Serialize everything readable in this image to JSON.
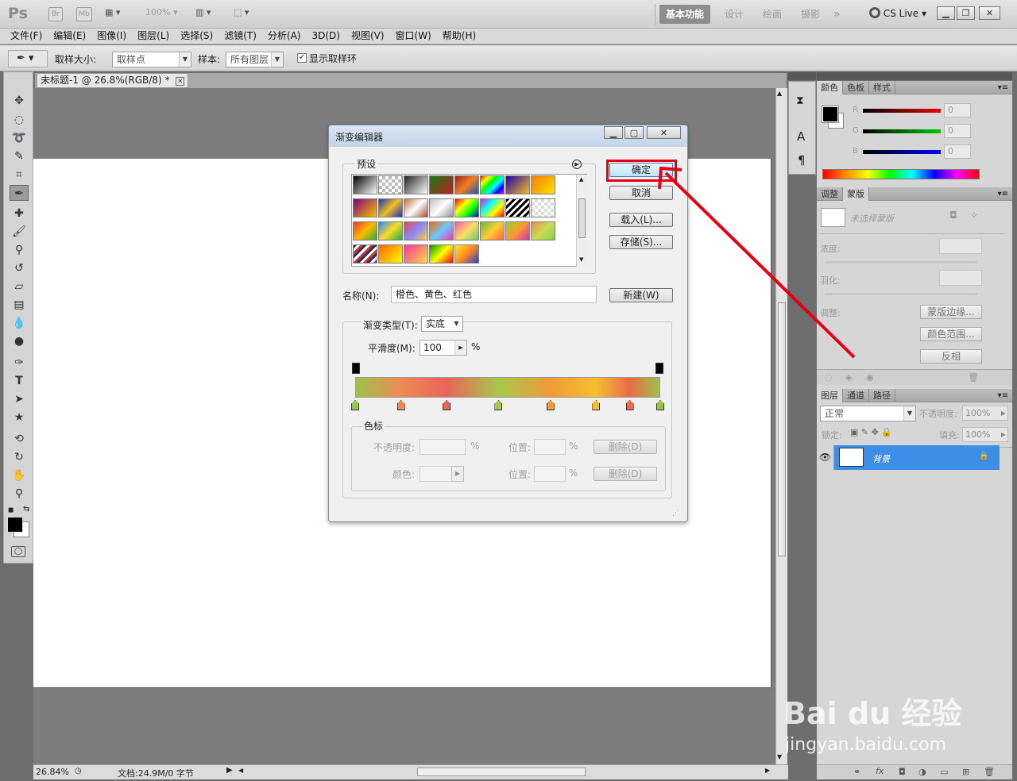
{
  "app": {
    "logo": "Ps",
    "bridge": "Br",
    "minibridge": "Mb",
    "zoom": "100%",
    "workspaces": [
      "基本功能",
      "设计",
      "绘画",
      "摄影"
    ],
    "more": "»",
    "cslive": "CS Live"
  },
  "menu": [
    "文件(F)",
    "编辑(E)",
    "图像(I)",
    "图层(L)",
    "选择(S)",
    "滤镜(T)",
    "分析(A)",
    "3D(D)",
    "视图(V)",
    "窗口(W)",
    "帮助(H)"
  ],
  "options": {
    "sample_size_label": "取样大小:",
    "sample_size_value": "取样点",
    "sample_label": "样本:",
    "sample_value": "所有图层",
    "show_ring_label": "显示取样环"
  },
  "document": {
    "tab_title": "未标题-1 @ 26.8%(RGB/8) *",
    "zoom": "26.84%",
    "doc_info": "文档:24.9M/0 字节"
  },
  "panels": {
    "color_tabs": [
      "颜色",
      "色板",
      "样式"
    ],
    "rgb_labels": [
      "R",
      "G",
      "B"
    ],
    "rgb_values": [
      "0",
      "0",
      "0"
    ],
    "mask_tabs": [
      "调整",
      "蒙版"
    ],
    "mask_status": "未选择蒙版",
    "density_label": "浓度:",
    "feather_label": "羽化:",
    "refine_label": "调整:",
    "mask_edge_btn": "蒙版边缘...",
    "color_range_btn": "颜色范围...",
    "invert_btn": "反相",
    "layers_tabs": [
      "图层",
      "通道",
      "路径"
    ],
    "blend_mode": "正常",
    "opacity_label": "不透明度:",
    "opacity_value": "100%",
    "lock_label": "锁定:",
    "fill_label": "填充:",
    "fill_value": "100%",
    "layer_name": "背景"
  },
  "dialog": {
    "title": "渐变编辑器",
    "presets_label": "预设",
    "ok": "确定",
    "cancel": "取消",
    "load": "载入(L)...",
    "save": "存储(S)...",
    "name_label": "名称(N):",
    "name_value": "橙色、黄色、红色",
    "new_btn": "新建(W)",
    "type_label": "渐变类型(T):",
    "type_value": "实底",
    "smooth_label": "平滑度(M):",
    "smooth_value": "100",
    "percent": "%",
    "stops_label": "色标",
    "opacity_label": "不透明度:",
    "color_label": "颜色:",
    "location_label": "位置:",
    "delete_btn": "删除(D)",
    "gradient_stops": [
      {
        "color": "#9bc24a",
        "pos": 0
      },
      {
        "color": "#ef8a55",
        "pos": 15
      },
      {
        "color": "#e8645a",
        "pos": 30
      },
      {
        "color": "#a6c84b",
        "pos": 47
      },
      {
        "color": "#f29a3a",
        "pos": 64
      },
      {
        "color": "#f4c030",
        "pos": 79
      },
      {
        "color": "#ec6a48",
        "pos": 90
      },
      {
        "color": "#9bc24a",
        "pos": 100
      }
    ]
  },
  "accent": {
    "highlight_red": "#e60012",
    "selected_blue": "#3d8ee6"
  },
  "watermark": {
    "brand": "Bai du 经验",
    "url": "jingyan.baidu.com"
  }
}
